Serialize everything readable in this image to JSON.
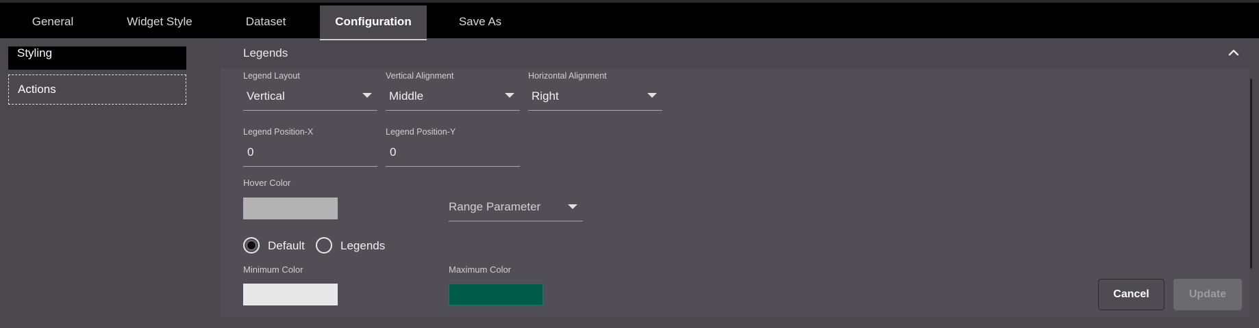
{
  "tabs": [
    {
      "label": "General"
    },
    {
      "label": "Widget Style"
    },
    {
      "label": "Dataset"
    },
    {
      "label": "Configuration",
      "active": true
    },
    {
      "label": "Save As"
    }
  ],
  "sidebar": {
    "items": [
      {
        "label": "Styling"
      },
      {
        "label": "Actions"
      }
    ]
  },
  "section": {
    "title": "Legends",
    "collapse_icon": "chevron-up-icon"
  },
  "fields": {
    "legend_layout": {
      "label": "Legend Layout",
      "value": "Vertical"
    },
    "vertical_alignment": {
      "label": "Vertical Alignment",
      "value": "Middle"
    },
    "horizontal_alignment": {
      "label": "Horizontal Alignment",
      "value": "Right"
    },
    "legend_position_x": {
      "label": "Legend Position-X",
      "value": "0"
    },
    "legend_position_y": {
      "label": "Legend Position-Y",
      "value": "0"
    },
    "hover_color": {
      "label": "Hover Color",
      "color": "#b3b3b3"
    },
    "range_parameter": {
      "value": "Range Parameter"
    },
    "mode": {
      "options": [
        {
          "label": "Default",
          "checked": true
        },
        {
          "label": "Legends",
          "checked": false
        }
      ]
    },
    "minimum_color": {
      "label": "Minimum Color",
      "color": "#e8e8e8"
    },
    "maximum_color": {
      "label": "Maximum Color",
      "color": "#005c48"
    }
  },
  "buttons": {
    "cancel": "Cancel",
    "update": "Update"
  }
}
